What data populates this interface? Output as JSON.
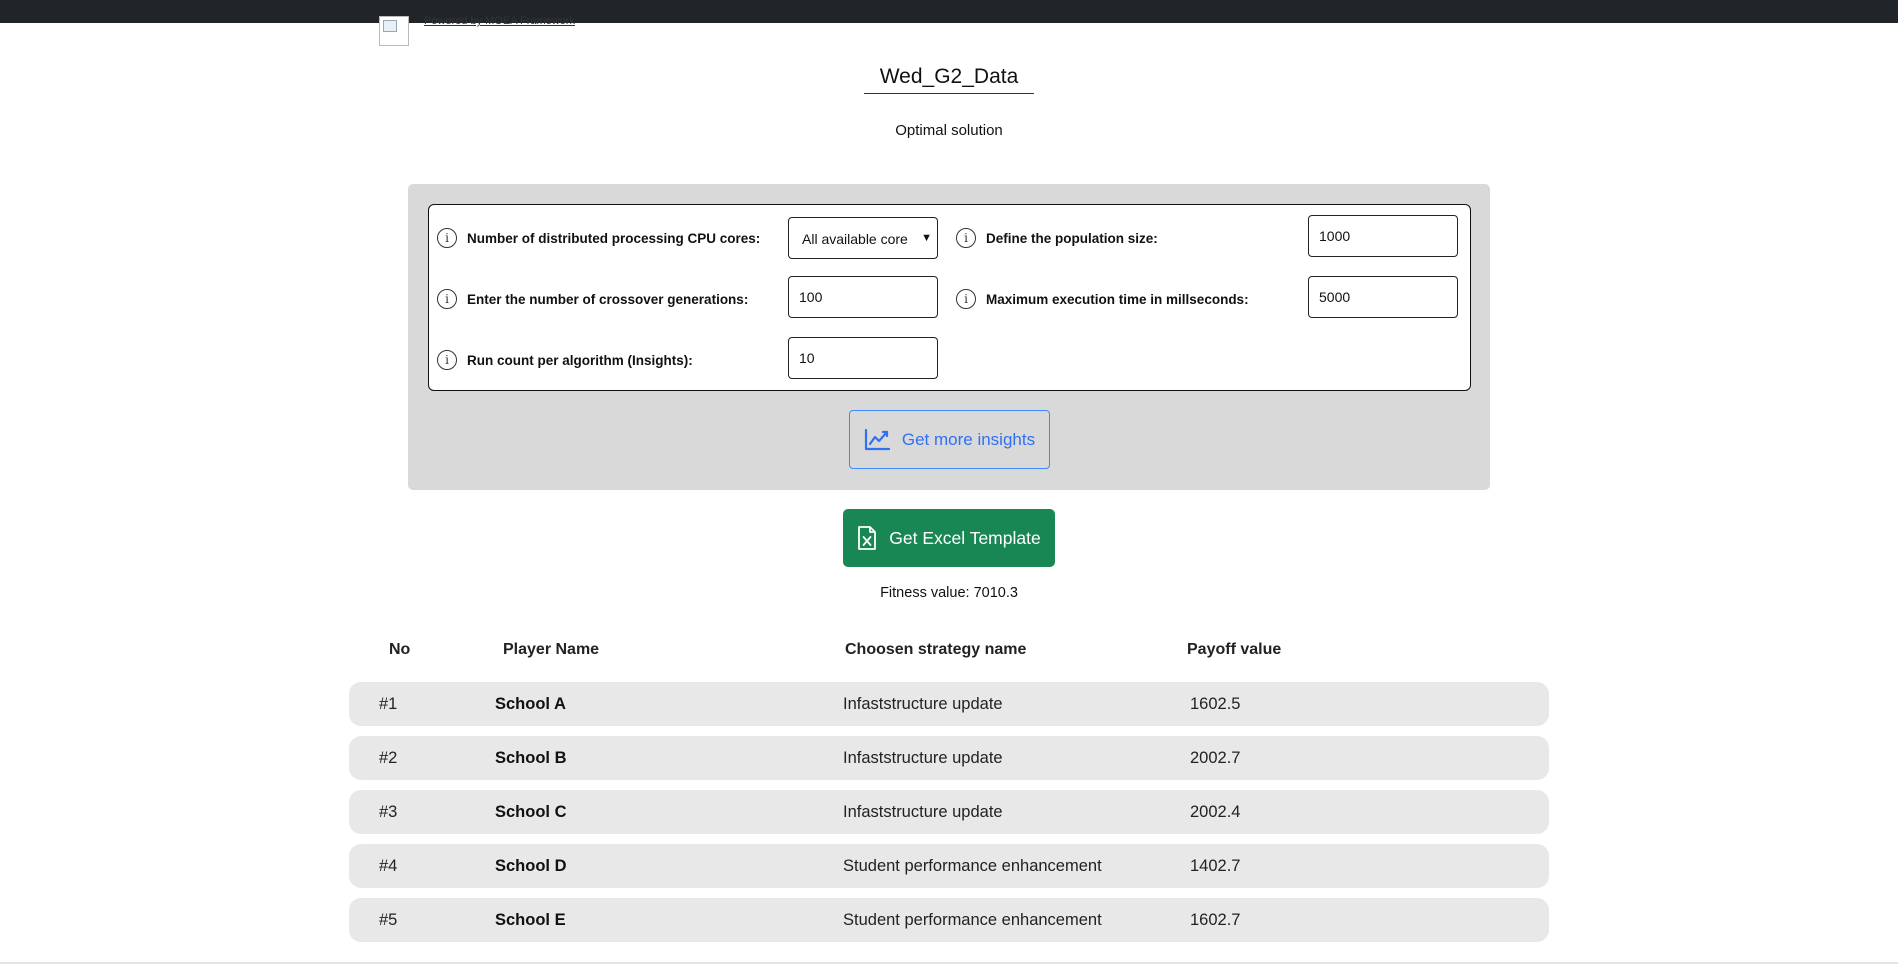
{
  "header": {
    "powered_by": "Powered by MOEA Framework",
    "title": "Wed_G2_Data",
    "subtitle": "Optimal solution"
  },
  "settings": {
    "cpu_cores": {
      "label": "Number of distributed processing CPU cores:",
      "selected": "All available core"
    },
    "population": {
      "label": "Define the population size:",
      "value": "1000"
    },
    "generations": {
      "label": "Enter the number of crossover generations:",
      "value": "100"
    },
    "max_time": {
      "label": "Maximum execution time in millseconds:",
      "value": "5000"
    },
    "run_count": {
      "label": "Run count per algorithm (Insights):",
      "value": "10"
    }
  },
  "buttons": {
    "insights": "Get more insights",
    "excel": "Get Excel Template"
  },
  "fitness": "Fitness value: 7010.3",
  "table": {
    "headers": [
      "No",
      "Player Name",
      "Choosen strategy name",
      "Payoff value"
    ],
    "rows": [
      {
        "no": "#1",
        "player": "School A",
        "strategy": "Infaststructure update",
        "payoff": "1602.5"
      },
      {
        "no": "#2",
        "player": "School B",
        "strategy": "Infaststructure update",
        "payoff": "2002.7"
      },
      {
        "no": "#3",
        "player": "School C",
        "strategy": "Infaststructure update",
        "payoff": "2002.4"
      },
      {
        "no": "#4",
        "player": "School D",
        "strategy": "Student performance enhancement",
        "payoff": "1402.7"
      },
      {
        "no": "#5",
        "player": "School E",
        "strategy": "Student performance enhancement",
        "payoff": "1602.7"
      }
    ]
  },
  "colors": {
    "topbar": "#212529",
    "panel": "#d9d9d9",
    "accent_blue": "#3071f3",
    "excel_green": "#198754",
    "row_bg": "#e9e8e9"
  },
  "icons": {
    "info": "info-circle-icon",
    "insights": "line-chart-icon",
    "excel": "excel-file-icon",
    "select": "chevron-down-icon"
  }
}
